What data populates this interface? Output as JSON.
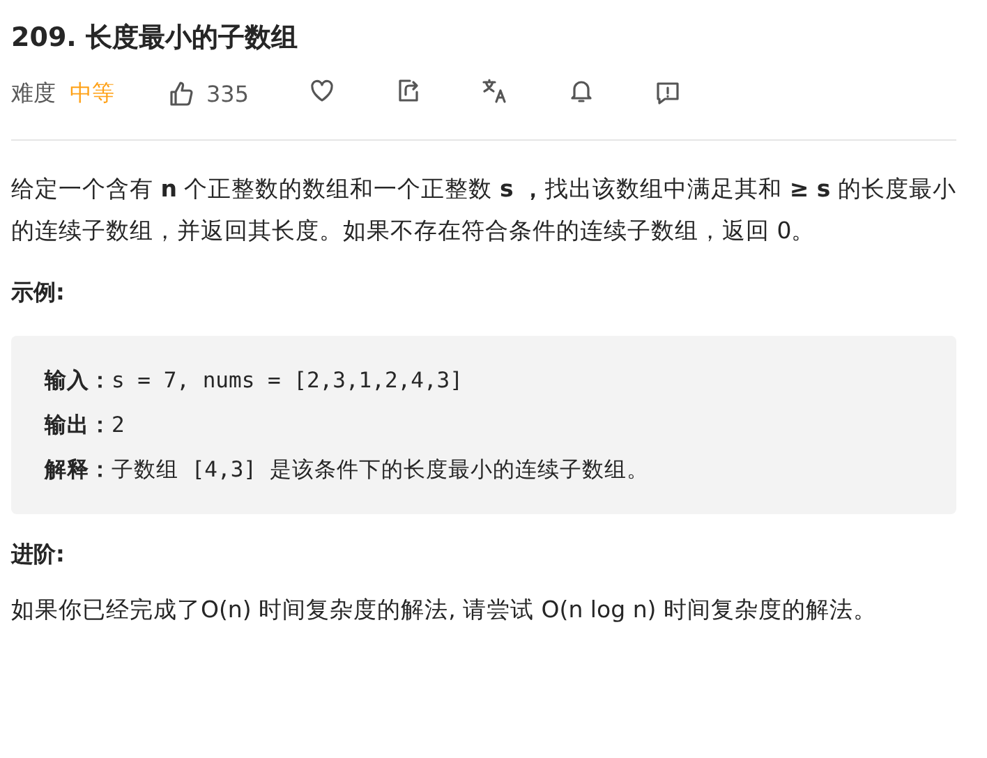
{
  "title": "209. 长度最小的子数组",
  "meta": {
    "difficulty_label": "难度",
    "difficulty": "中等",
    "likes": "335"
  },
  "description": "给定一个含有 **n** 个正整数的数组和一个正整数 **s ，**找出该数组中满足其和 **≥ s** 的长度最小的连续子数组，并返回其长度。如果不存在符合条件的连续子数组，返回 0。",
  "example": {
    "heading": "示例:",
    "lines": [
      {
        "label": "输入：",
        "text": "s = 7, nums = [2,3,1,2,4,3]"
      },
      {
        "label": "输出：",
        "text": "2"
      },
      {
        "label": "解释：",
        "text": "子数组 [4,3] 是该条件下的长度最小的连续子数组。"
      }
    ]
  },
  "follow_up": {
    "heading": "进阶:",
    "text": "如果你已经完成了O(n) 时间复杂度的解法, 请尝试 O(n log n) 时间复杂度的解法。"
  }
}
